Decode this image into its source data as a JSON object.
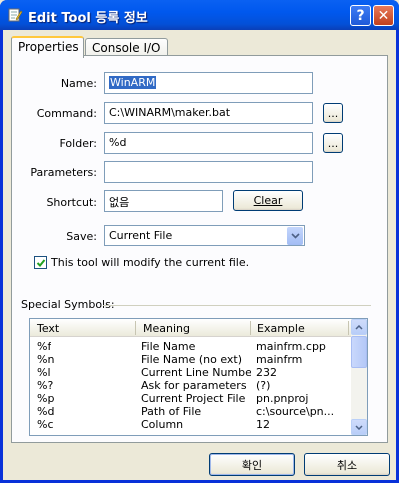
{
  "window": {
    "title": "Edit Tool 등록 정보",
    "help_label": "?",
    "close_label": "✕"
  },
  "tabs": [
    {
      "label": "Properties",
      "active": true
    },
    {
      "label": "Console I/O",
      "active": false
    }
  ],
  "form": {
    "name_label": "Name:",
    "name_value": "WinARM",
    "command_label": "Command:",
    "command_value": "C:\\WINARM\\maker.bat",
    "command_browse": "...",
    "folder_label": "Folder:",
    "folder_value": "%d",
    "folder_browse": "...",
    "parameters_label": "Parameters:",
    "parameters_value": "",
    "shortcut_label": "Shortcut:",
    "shortcut_value": "없음",
    "clear_label": "Clear",
    "save_label": "Save:",
    "save_value": "Current File",
    "modify_checkbox_label": "This tool will modify the current file.",
    "modify_checked": true
  },
  "symbols": {
    "group_label": "Special Symbols:",
    "columns": [
      "Text",
      "Meaning",
      "Example"
    ],
    "rows": [
      [
        "%f",
        "File Name",
        "mainfrm.cpp"
      ],
      [
        "%n",
        "File Name (no ext)",
        "mainfrm"
      ],
      [
        "%l",
        "Current Line Number",
        "232"
      ],
      [
        "%?",
        "Ask for parameters",
        "(?)"
      ],
      [
        "%p",
        "Current Project File",
        "pn.pnproj"
      ],
      [
        "%d",
        "Path of File",
        "c:\\source\\pn..."
      ],
      [
        "%c",
        "Column",
        "12"
      ]
    ]
  },
  "footer": {
    "ok_label": "확인",
    "cancel_label": "취소"
  },
  "colors": {
    "titlebar": "#0058ee",
    "selection": "#316ac5",
    "dialog_bg": "#ece9d8"
  },
  "icons": {
    "title": "notepad-pencil-icon"
  }
}
